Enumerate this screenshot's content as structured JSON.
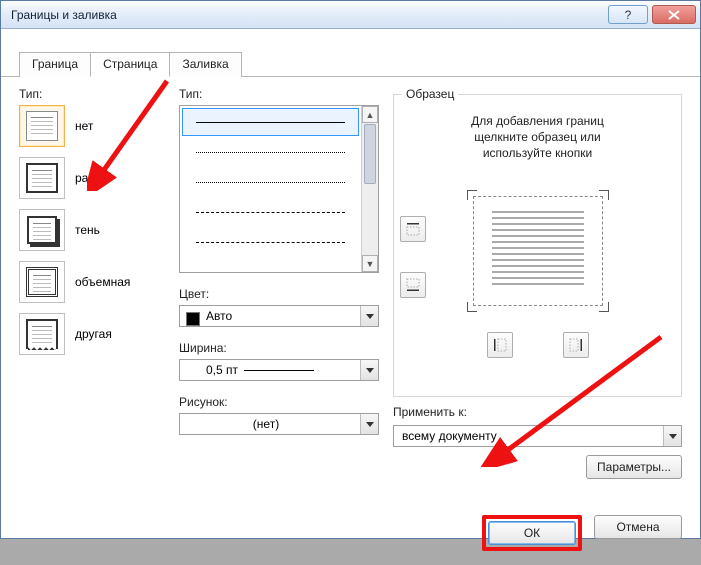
{
  "window": {
    "title": "Границы и заливка"
  },
  "tabs": {
    "border": "Граница",
    "page": "Страница",
    "fill": "Заливка"
  },
  "left": {
    "title": "Тип:",
    "opts": {
      "none": "нет",
      "frame": "рамка",
      "shadow": "тень",
      "vol": "объемная",
      "other": "другая"
    }
  },
  "styles": {
    "title": "Тип:"
  },
  "color": {
    "title": "Цвет:",
    "value": "Авто"
  },
  "width": {
    "title": "Ширина:",
    "value": "0,5 пт"
  },
  "art": {
    "title": "Рисунок:",
    "value": "(нет)"
  },
  "sample": {
    "title": "Образец",
    "msg_l1": "Для добавления границ",
    "msg_l2": "щелкните образец или",
    "msg_l3": "используйте кнопки"
  },
  "apply": {
    "title": "Применить к:",
    "value": "всему документу"
  },
  "buttons": {
    "params": "Параметры...",
    "ok": "ОК",
    "cancel": "Отмена"
  }
}
